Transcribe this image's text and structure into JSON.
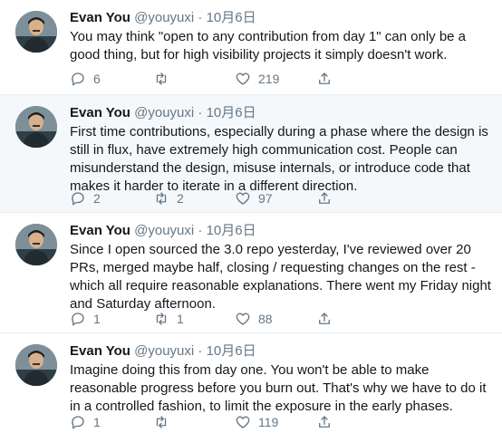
{
  "tweets": [
    {
      "name": "Evan You",
      "handle": "@youyuxi",
      "dot": "·",
      "date": "10月6日",
      "text": "You may think \"open to any contribution from day 1\" can only be a good thing, but for high visibility projects it simply doesn't work.",
      "replies": "6",
      "retweets": "",
      "likes": "219",
      "highlighted": false
    },
    {
      "name": "Evan You",
      "handle": "@youyuxi",
      "dot": "·",
      "date": "10月6日",
      "text": "First time contributions, especially during a phase where the design is still in flux, have extremely high communication cost. People can misunderstand the design, misuse internals, or introduce code that makes it harder to iterate in a different direction.",
      "replies": "2",
      "retweets": "2",
      "likes": "97",
      "highlighted": true
    },
    {
      "name": "Evan You",
      "handle": "@youyuxi",
      "dot": "·",
      "date": "10月6日",
      "text": "Since I open sourced the 3.0 repo yesterday, I've reviewed over 20 PRs, merged maybe half, closing / requesting changes on the rest - which all require reasonable explanations. There went my Friday night and Saturday afternoon.",
      "replies": "1",
      "retweets": "1",
      "likes": "88",
      "highlighted": false
    },
    {
      "name": "Evan You",
      "handle": "@youyuxi",
      "dot": "·",
      "date": "10月6日",
      "text": "Imagine doing this from day one. You won't be able to make reasonable progress before you burn out. That's why we have to do it in a controlled fashion, to limit the exposure in the early phases.",
      "replies": "1",
      "retweets": "",
      "likes": "119",
      "highlighted": false
    }
  ],
  "icons": {
    "reply": "reply-icon",
    "retweet": "retweet-icon",
    "like": "heart-icon",
    "share": "share-icon"
  },
  "colors": {
    "text": "#14171a",
    "secondary": "#657786",
    "highlight_bg": "#f5f8fa",
    "divider": "#e6ecf0"
  }
}
